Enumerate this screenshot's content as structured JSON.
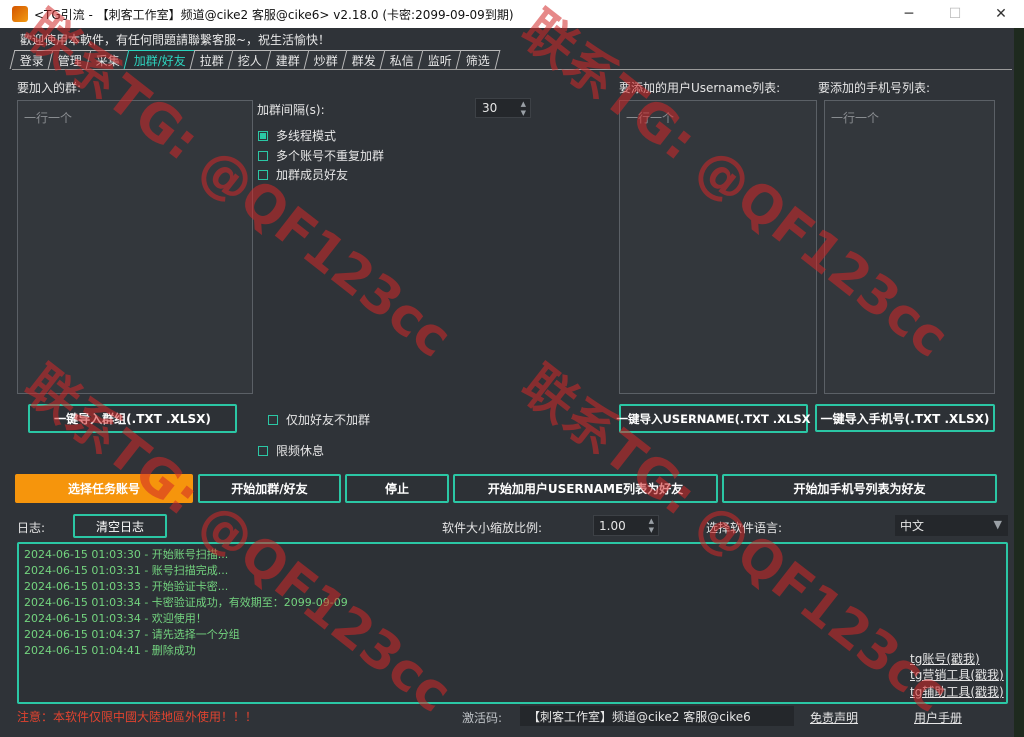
{
  "window": {
    "title": "<TG引流 - 【刺客工作室】频道@cike2 客服@cike6> v2.18.0 (卡密:2099-09-09到期)",
    "minimize": "─",
    "maximize": "☐",
    "close": "✕"
  },
  "welcome": "歡迎使用本軟件，有任何問題請聯繫客服~，祝生活愉快！",
  "tabs": [
    "登录",
    "管理",
    "采集",
    "加群/好友",
    "拉群",
    "挖人",
    "建群",
    "炒群",
    "群发",
    "私信",
    "监听",
    "筛选"
  ],
  "active_tab": "加群/好友",
  "groups": {
    "label": "要加入的群:",
    "placeholder": "一行一个",
    "import_button": "一键导入群组(.TXT .XLSX)"
  },
  "settings": {
    "interval_label": "加群间隔(s):",
    "interval_value": "30",
    "multithread": "多线程模式",
    "multithread_checked": true,
    "no_repeat": "多个账号不重复加群",
    "no_repeat_checked": false,
    "add_members": "加群成员好友",
    "add_members_checked": false,
    "friends_only": "仅加好友不加群",
    "friends_only_checked": false,
    "rate_limit": "限频休息",
    "rate_limit_checked": false
  },
  "usernames": {
    "label": "要添加的用户Username列表:",
    "placeholder": "一行一个",
    "import_button": "一键导入USERNAME(.TXT .XLSX"
  },
  "phones": {
    "label": "要添加的手机号列表:",
    "placeholder": "一行一个",
    "import_button": "一键导入手机号(.TXT .XLSX)"
  },
  "actions": {
    "select_account": "选择任务账号",
    "start_join": "开始加群/好友",
    "stop": "停止",
    "start_username": "开始加用户USERNAME列表为好友",
    "start_phone": "开始加手机号列表为好友"
  },
  "log": {
    "label": "日志:",
    "clear_button": "清空日志",
    "scale_label": "软件大小缩放比例:",
    "scale_value": "1.00",
    "lang_label": "选择软件语言:",
    "lang_value": "中文",
    "lines": [
      "2024-06-15 01:03:30 - 开始账号扫描...",
      "2024-06-15 01:03:31 - 账号扫描完成...",
      "2024-06-15 01:03:33 - 开始验证卡密...",
      "2024-06-15 01:03:34 - 卡密验证成功，有效期至：2099-09-09",
      "2024-06-15 01:03:34 - 欢迎使用！",
      "2024-06-15 01:04:37 - 请先选择一个分组",
      "2024-06-15 01:04:41 - 删除成功"
    ],
    "links": [
      "tg账号(戳我)",
      "tg营销工具(戳我)",
      "tg辅助工具(戳我)"
    ]
  },
  "footer": {
    "notice": "注意：本软件仅限中國大陸地區外使用！！！",
    "activation_label": "激活码:",
    "activation_value": "【刺客工作室】频道@cike2 客服@cike6",
    "disclaimer": "免责声明",
    "manual": "用户手册"
  },
  "watermark": "联系TG: @QF123cc",
  "colors": {
    "accent": "#2bc7a5",
    "orange": "#f6950c",
    "log_text": "#73d47f",
    "notice": "#e0432f"
  }
}
